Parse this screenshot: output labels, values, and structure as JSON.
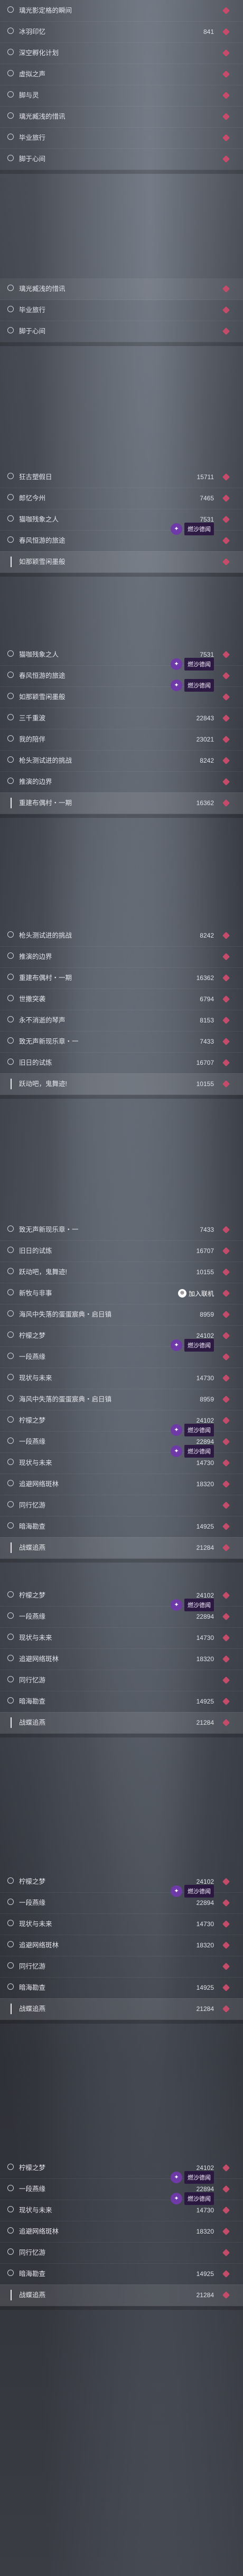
{
  "colors": {
    "accent_diamond": "#c64a6a",
    "badge_purple": "#6d3aa8",
    "text": "#e3e5ea"
  },
  "icons": {
    "row_marker": "ring-icon",
    "action": "diamond-icon",
    "badge": "sparkle-badge-icon",
    "join": "join-icon"
  },
  "screens": [
    {
      "rows": [
        {
          "title": "璃光影定格的瞬间",
          "marker": "ring"
        },
        {
          "title": "冰羽印忆",
          "hot": "841",
          "marker": "ring"
        },
        {
          "title": "深空孵化计划",
          "marker": "ring"
        },
        {
          "title": "虚拟之声",
          "marker": "ring"
        },
        {
          "title": "脚与灵",
          "marker": "ring"
        },
        {
          "title": "璃光臧浅的惜讯",
          "marker": "ring"
        },
        {
          "title": "毕业旅行",
          "marker": "ring"
        },
        {
          "title": "脚于心间",
          "marker": "ring"
        }
      ]
    },
    {
      "rows": [
        {
          "title": "璃光臧浅的惜讯",
          "marker": "ring",
          "highlight": true
        },
        {
          "title": "毕业旅行",
          "marker": "ring"
        },
        {
          "title": "脚于心间",
          "marker": "ring"
        }
      ]
    },
    {
      "rows": [
        {
          "title": "狂古塑假日",
          "hot": "15711",
          "marker": "ring"
        },
        {
          "title": "郎忆今州",
          "hot": "7465",
          "marker": "ring"
        },
        {
          "title": "猫咖残象之人",
          "hot": "7531",
          "marker": "ring"
        },
        {
          "title": "春风恒游的旅途",
          "marker": "ring",
          "tag": "燃沙德闻"
        },
        {
          "title": "如那颖雪闲墨般",
          "marker": "bar",
          "selected": true
        }
      ]
    },
    {
      "rows": [
        {
          "title": "猫咖残象之人",
          "hot": "7531",
          "marker": "ring"
        },
        {
          "title": "春风恒游的旅途",
          "marker": "ring",
          "tag": "燃沙德闻"
        },
        {
          "title": "如那颖雪闲墨般",
          "marker": "ring",
          "tag": "燃沙德闻"
        },
        {
          "title": "三千重波",
          "hot": "22843",
          "marker": "ring"
        },
        {
          "title": "我的陪伴",
          "hot": "23021",
          "marker": "ring"
        },
        {
          "title": "枪头测试进的挑战",
          "hot": "8242",
          "marker": "ring"
        },
        {
          "title": "推演的边界",
          "marker": "ring"
        },
        {
          "title": "重建布偶村・一期",
          "hot": "16362",
          "marker": "bar",
          "selected": true
        }
      ]
    },
    {
      "rows": [
        {
          "title": "枪头测试进的挑战",
          "hot": "8242",
          "marker": "ring"
        },
        {
          "title": "推演的边界",
          "marker": "ring"
        },
        {
          "title": "重建布偶村・一期",
          "hot": "16362",
          "marker": "ring"
        },
        {
          "title": "世撒突袭",
          "hot": "6794",
          "marker": "ring"
        },
        {
          "title": "永不消逝的琴声",
          "hot": "8153",
          "marker": "ring"
        },
        {
          "title": "致无声新现乐章・一",
          "hot": "7433",
          "marker": "ring"
        },
        {
          "title": "旧日的试炼",
          "hot": "16707",
          "marker": "ring"
        },
        {
          "title": "跃动吧，鬼舞迹!",
          "hot": "10155",
          "marker": "bar",
          "selected": true
        }
      ]
    },
    {
      "rows": [
        {
          "title": "致无声新现乐章・一",
          "hot": "7433",
          "marker": "ring"
        },
        {
          "title": "旧日的试炼",
          "hot": "16707",
          "marker": "ring"
        },
        {
          "title": "跃动吧，鬼舞迹!",
          "hot": "10155",
          "marker": "ring"
        },
        {
          "title": "新牧与非事",
          "marker": "ring",
          "join": "加入联机"
        },
        {
          "title": "海风中失落的蛋蛋宸典・启日镇",
          "hot": "8959",
          "marker": "ring"
        },
        {
          "title": "柠檬之梦",
          "hot": "24102",
          "marker": "ring"
        },
        {
          "title": "一段燕缘",
          "marker": "ring",
          "tag": "燃沙德闻"
        },
        {
          "title": "现状与未来",
          "hot": "14730",
          "marker": "ring"
        },
        {
          "title": "海风中失落的蛋蛋宸典・启日镇",
          "hot": "8959",
          "marker": "ring"
        },
        {
          "title": "柠檬之梦",
          "hot": "24102",
          "marker": "ring"
        },
        {
          "title": "一段燕缘",
          "hot": "22894",
          "marker": "ring",
          "tag": "燃沙德闻"
        },
        {
          "title": "现状与未来",
          "hot": "14730",
          "marker": "ring",
          "tag": "燃沙德闻"
        },
        {
          "title": "追避网络斑林",
          "hot": "18320",
          "marker": "ring"
        },
        {
          "title": "同行忆游",
          "marker": "ring"
        },
        {
          "title": "暗海勘查",
          "hot": "14925",
          "marker": "ring"
        },
        {
          "title": "战蝶追燕",
          "hot": "21284",
          "marker": "bar",
          "selected": true
        }
      ]
    },
    {
      "rows": [
        {
          "title": "柠檬之梦",
          "hot": "24102",
          "marker": "ring"
        },
        {
          "title": "一段燕缘",
          "hot": "22894",
          "marker": "ring",
          "tag": "燃沙德闻"
        },
        {
          "title": "现状与未来",
          "hot": "14730",
          "marker": "ring"
        },
        {
          "title": "追避网络斑林",
          "hot": "18320",
          "marker": "ring"
        },
        {
          "title": "同行忆游",
          "marker": "ring"
        },
        {
          "title": "暗海勘查",
          "hot": "14925",
          "marker": "ring"
        },
        {
          "title": "战蝶追燕",
          "hot": "21284",
          "marker": "bar",
          "selected": true
        }
      ]
    },
    {
      "rows": [
        {
          "title": "柠檬之梦",
          "hot": "24102",
          "marker": "ring"
        },
        {
          "title": "一段燕缘",
          "hot": "22894",
          "marker": "ring",
          "tag": "燃沙德闻"
        },
        {
          "title": "现状与未来",
          "hot": "14730",
          "marker": "ring"
        },
        {
          "title": "追避网络斑林",
          "hot": "18320",
          "marker": "ring"
        },
        {
          "title": "同行忆游",
          "marker": "ring"
        },
        {
          "title": "暗海勘查",
          "hot": "14925",
          "marker": "ring"
        },
        {
          "title": "战蝶追燕",
          "hot": "21284",
          "marker": "bar",
          "selected": true
        }
      ]
    },
    {
      "rows": [
        {
          "title": "柠檬之梦",
          "hot": "24102",
          "marker": "ring"
        },
        {
          "title": "一段燕缘",
          "hot": "22894",
          "marker": "ring",
          "tag": "燃沙德闻"
        },
        {
          "title": "现状与未来",
          "hot": "14730",
          "marker": "ring",
          "tag": "燃沙德闻"
        },
        {
          "title": "追避网络斑林",
          "hot": "18320",
          "marker": "ring"
        },
        {
          "title": "同行忆游",
          "marker": "ring"
        },
        {
          "title": "暗海勘查",
          "hot": "14925",
          "marker": "ring"
        },
        {
          "title": "战蝶追燕",
          "hot": "21284",
          "marker": "bar",
          "selected": true
        }
      ]
    }
  ]
}
